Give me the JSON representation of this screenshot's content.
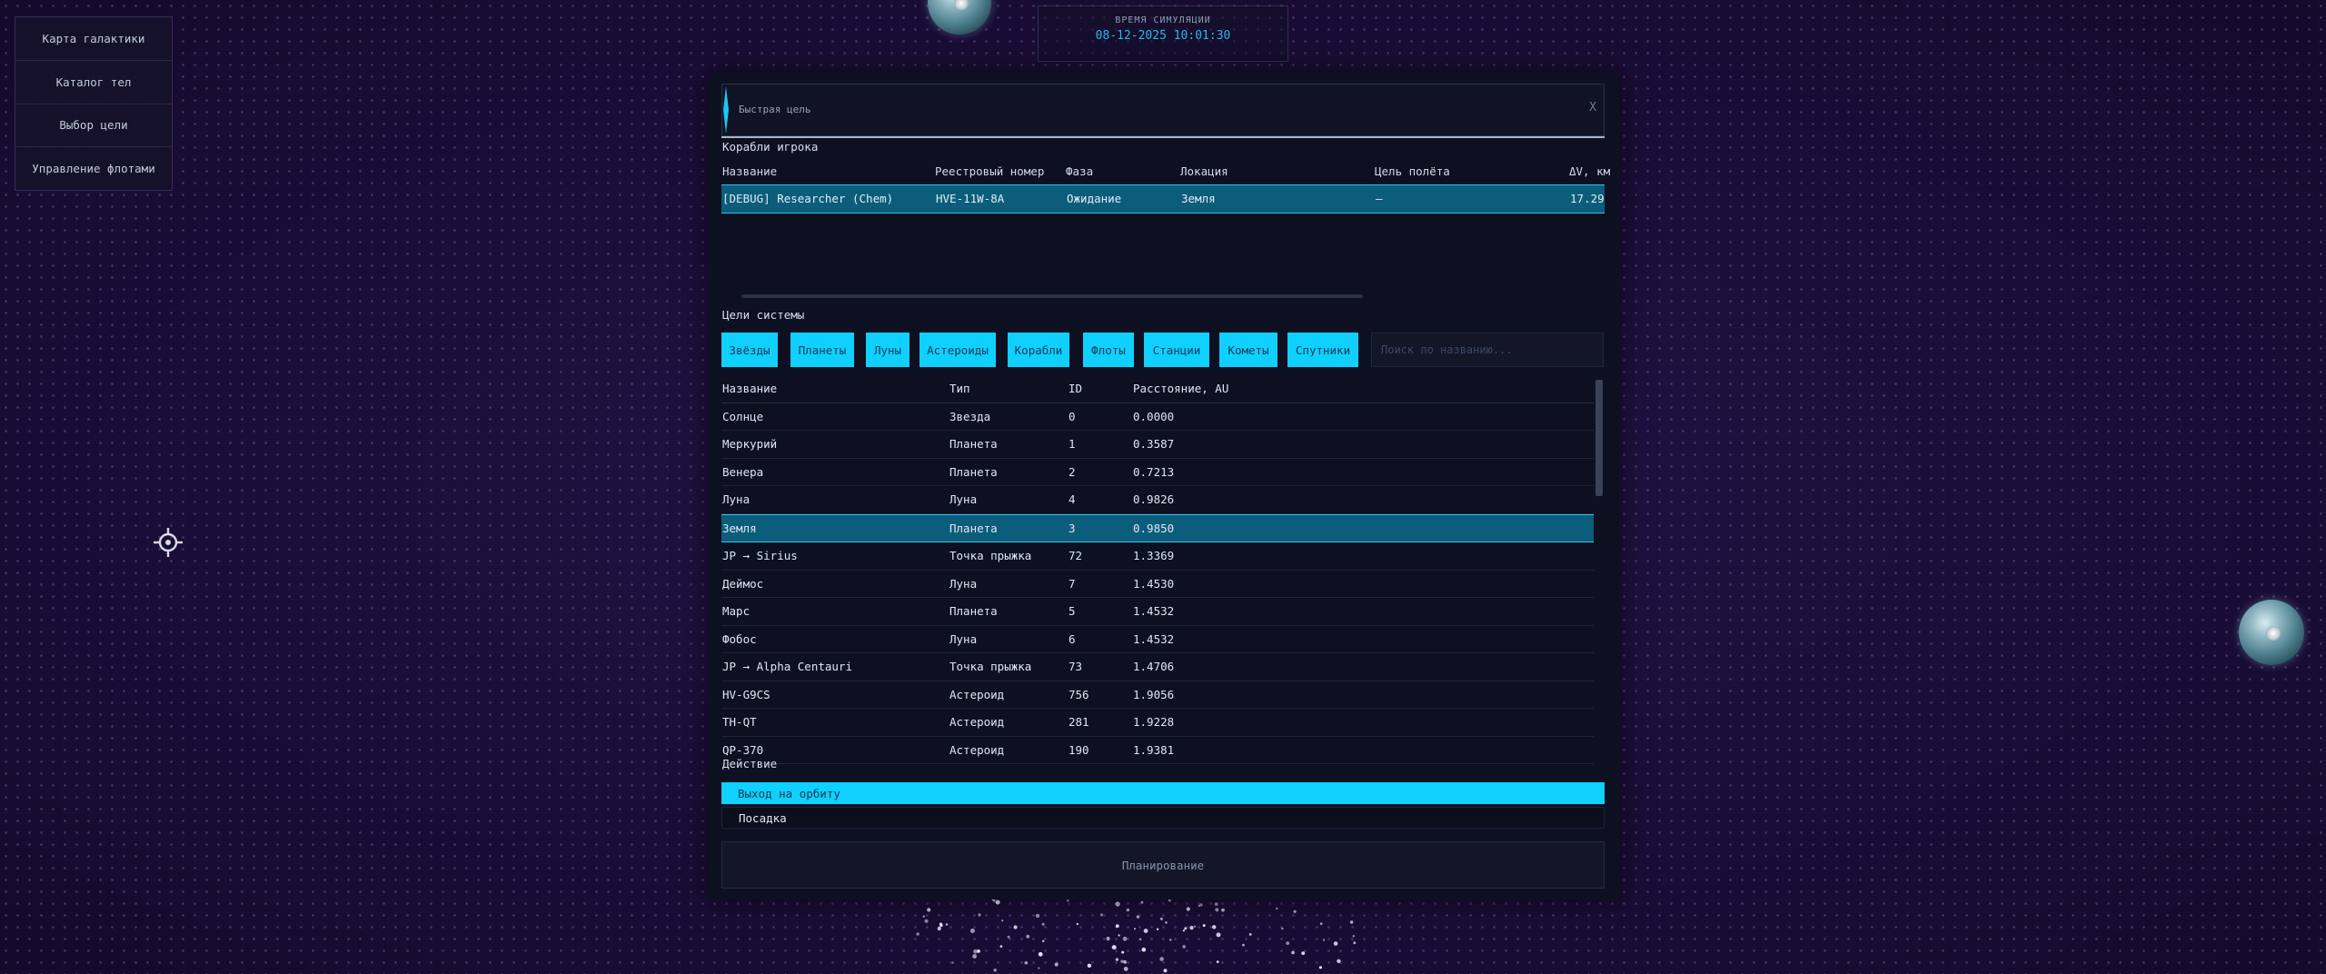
{
  "side_menu": {
    "items": [
      {
        "label": "Карта галактики"
      },
      {
        "label": "Каталог тел"
      },
      {
        "label": "Выбор цели"
      },
      {
        "label": "Управление флотами"
      }
    ]
  },
  "sim_time": {
    "label": "ВРЕМЯ СИМУЛЯЦИИ",
    "value": "08-12-2025 10:01:30"
  },
  "modal": {
    "title": "Быстрая цель",
    "close": "X",
    "accent_color": "#19c8f0",
    "ships_section": {
      "label": "Корабли игрока",
      "columns": [
        "Название",
        "Реестровый номер",
        "Фаза",
        "Локация",
        "Цель полёта",
        "ΔV, км"
      ],
      "rows": [
        {
          "name": "[DEBUG] Researcher (Chem)",
          "registry": "HVE-11W-8A",
          "phase": "Ожидание",
          "location": "Земля",
          "target": "—",
          "dv": "17.29"
        }
      ]
    },
    "targets_section": {
      "label": "Цели системы",
      "filters": [
        "Звёзды",
        "Планеты",
        "Луны",
        "Астероиды",
        "Корабли",
        "Флоты",
        "Станции",
        "Кометы",
        "Спутники"
      ],
      "search_placeholder": "Поиск по названию...",
      "columns": [
        "Название",
        "Тип",
        "ID",
        "Расстояние, AU"
      ],
      "rows": [
        {
          "name": "Солнце",
          "type": "Звезда",
          "id": "0",
          "distance": "0.0000"
        },
        {
          "name": "Меркурий",
          "type": "Планета",
          "id": "1",
          "distance": "0.3587"
        },
        {
          "name": "Венера",
          "type": "Планета",
          "id": "2",
          "distance": "0.7213"
        },
        {
          "name": "Луна",
          "type": "Луна",
          "id": "4",
          "distance": "0.9826"
        },
        {
          "name": "Земля",
          "type": "Планета",
          "id": "3",
          "distance": "0.9850",
          "selected": true
        },
        {
          "name": "JP → Sirius",
          "type": "Точка прыжка",
          "id": "72",
          "distance": "1.3369"
        },
        {
          "name": "Деймос",
          "type": "Луна",
          "id": "7",
          "distance": "1.4530"
        },
        {
          "name": "Марс",
          "type": "Планета",
          "id": "5",
          "distance": "1.4532"
        },
        {
          "name": "Фобос",
          "type": "Луна",
          "id": "6",
          "distance": "1.4532"
        },
        {
          "name": "JP → Alpha Centauri",
          "type": "Точка прыжка",
          "id": "73",
          "distance": "1.4706"
        },
        {
          "name": "HV-G9CS",
          "type": "Астероид",
          "id": "756",
          "distance": "1.9056"
        },
        {
          "name": "TH-QT",
          "type": "Астероид",
          "id": "281",
          "distance": "1.9228"
        },
        {
          "name": "QP-370",
          "type": "Астероид",
          "id": "190",
          "distance": "1.9381"
        }
      ]
    },
    "action_section": {
      "label": "Действие",
      "options": [
        {
          "label": "Выход на орбиту",
          "active": true
        },
        {
          "label": "Посадка",
          "active": false
        }
      ]
    },
    "plan_button": "Планирование"
  },
  "colors": {
    "accent": "#0fd0ff",
    "selected_row": "#0b5d7b",
    "background": "#1c0f3a"
  }
}
